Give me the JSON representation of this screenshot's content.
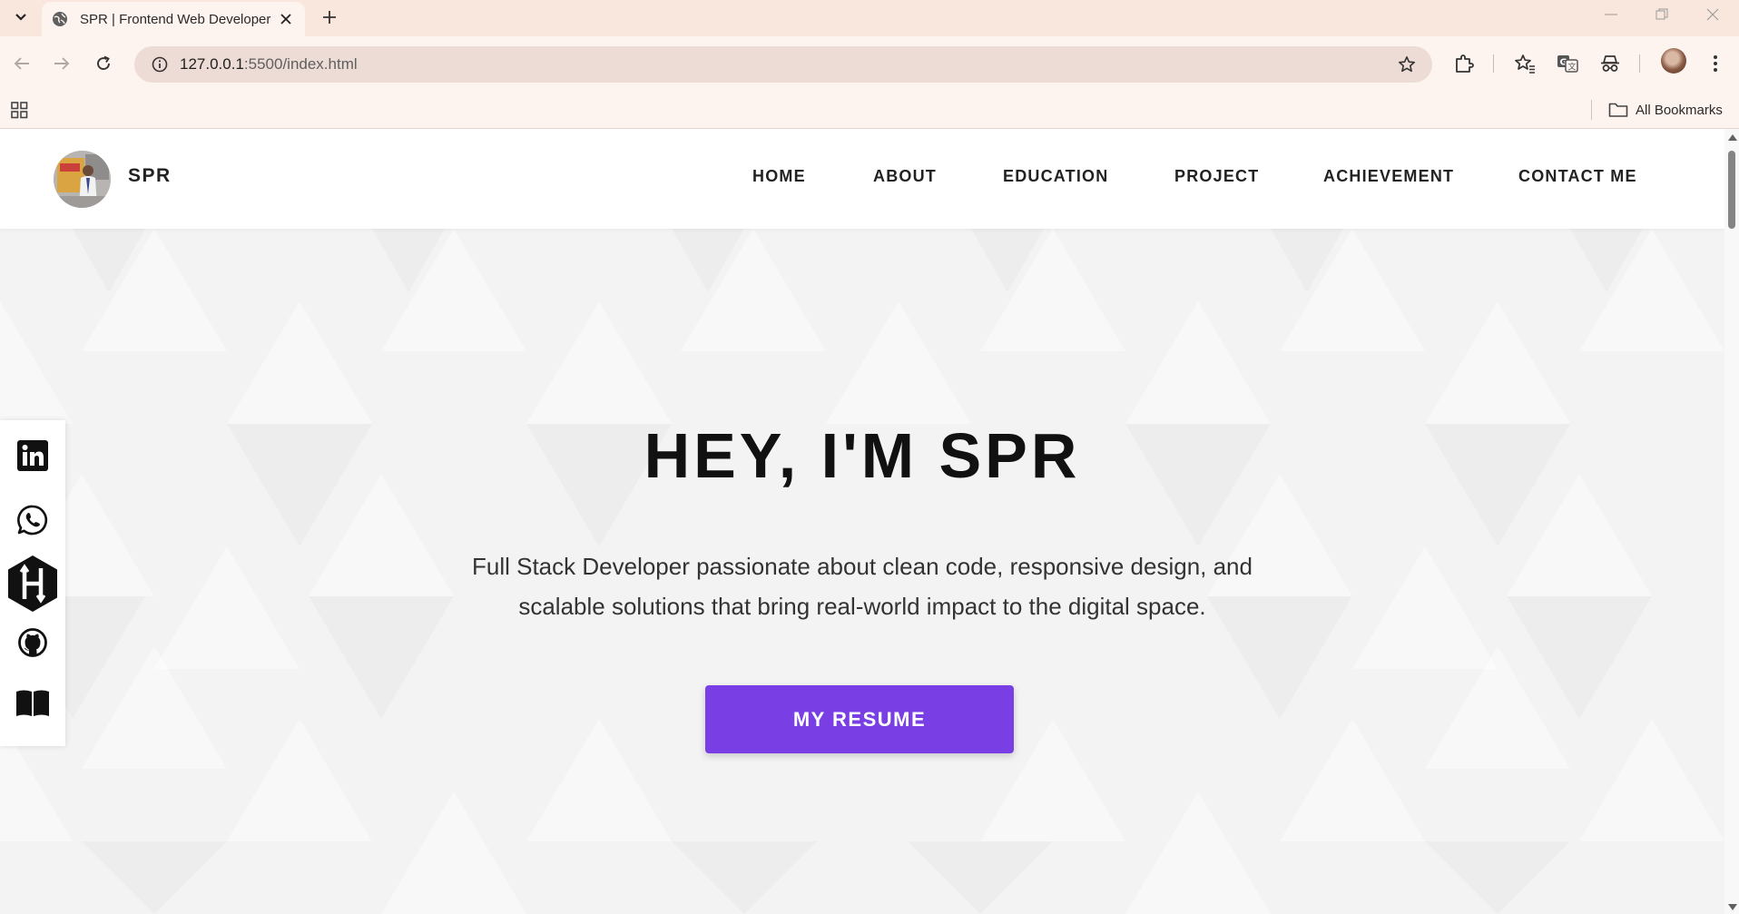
{
  "browser": {
    "tab_title": "SPR | Frontend Web Developer",
    "url_host": "127.0.0.1",
    "url_rest": ":5500/index.html",
    "bookmarks_label": "All Bookmarks",
    "icons": [
      "tab-search-icon",
      "globe-icon",
      "close-icon",
      "plus-icon",
      "minimize-icon",
      "restore-icon",
      "window-close-icon",
      "back-icon",
      "forward-icon",
      "reload-icon",
      "info-icon",
      "star-icon",
      "extensions-icon",
      "bookmark-star-icon",
      "translate-icon",
      "incognito-icon",
      "profile-avatar",
      "kebab-menu-icon",
      "apps-grid-icon",
      "folder-icon"
    ]
  },
  "site": {
    "logo_text": "SPR",
    "nav": [
      {
        "label": "HOME"
      },
      {
        "label": "ABOUT"
      },
      {
        "label": "EDUCATION"
      },
      {
        "label": "PROJECT"
      },
      {
        "label": "ACHIEVEMENT"
      },
      {
        "label": "CONTACT ME"
      }
    ],
    "hero": {
      "title": "HEY, I'M SPR",
      "subtitle": "Full Stack Developer passionate about clean code, responsive design, and scalable solutions that bring real-world impact to the digital space.",
      "button": "MY RESUME"
    },
    "social": [
      "linkedin-icon",
      "whatsapp-icon",
      "hackerrank-icon",
      "github-icon",
      "book-icon"
    ]
  },
  "colors": {
    "accent": "#7a3fe4",
    "chrome_tab_bar": "#f9e6dc",
    "chrome_toolbar": "#fdf3ef",
    "hero_background": "#f3f3f3"
  }
}
